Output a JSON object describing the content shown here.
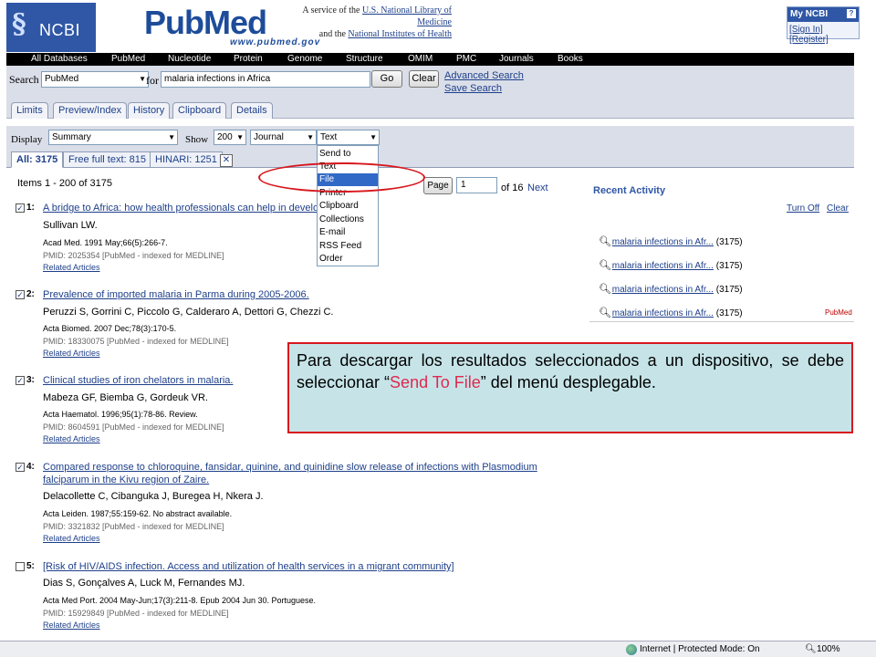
{
  "header": {
    "ncbi_logo_text": "NCBI",
    "ncbi_helix_glyph": "§",
    "pubmed_logo": "PubMed",
    "pubmed_url": "www.pubmed.gov",
    "service_line1_prefix": "A service of the ",
    "service_line1_link": "U.S. National Library of Medicine",
    "service_line2_prefix": "and the ",
    "service_line2_link": "National Institutes of Health",
    "myncbi_title": "My NCBI",
    "myncbi_help": "?",
    "sign_in": "[Sign In]",
    "register": "[Register]"
  },
  "nav": {
    "items": [
      "All Databases",
      "PubMed",
      "Nucleotide",
      "Protein",
      "Genome",
      "Structure",
      "OMIM",
      "PMC",
      "Journals",
      "Books"
    ]
  },
  "search": {
    "label": "Search",
    "database": "PubMed",
    "for_label": "for",
    "query": "malaria infections in Africa",
    "go_label": "Go",
    "clear_label": "Clear",
    "advanced_search": "Advanced Search",
    "save_search": "Save Search"
  },
  "tabs": [
    "Limits",
    "Preview/Index",
    "History",
    "Clipboard",
    "Details"
  ],
  "display": {
    "label": "Display",
    "format": "Summary",
    "show_label": "Show",
    "show_count": "200",
    "sort": "Journal",
    "send_format": "Text"
  },
  "filters": [
    {
      "label": "All: 3175",
      "active": true
    },
    {
      "label": "Free full text: 815",
      "active": false
    },
    {
      "label": "HINARI: 1251",
      "active": false
    }
  ],
  "paging": {
    "items_text": "Items 1 - 200 of 3175",
    "page_button": "Page",
    "page_value": "1",
    "of_text": "of 16",
    "next": "Next"
  },
  "dropdown": {
    "options": [
      "Send to",
      "Text",
      "File",
      "Printer",
      "Clipboard",
      "Collections",
      "E-mail",
      "RSS Feed",
      "Order"
    ],
    "selected": "File"
  },
  "results": [
    {
      "num": "1:",
      "checked": "✓",
      "title": "A bridge to Africa: how health professionals can help in developing countries.",
      "authors": "Sullivan LW.",
      "source": "Acad Med. 1991 May;66(5):266-7.",
      "pmid": "PMID: 2025354 [PubMed - indexed for MEDLINE]",
      "related": "Related Articles"
    },
    {
      "num": "2:",
      "checked": "✓",
      "title": "Prevalence of imported malaria in Parma during 2005-2006.",
      "authors": "Peruzzi S, Gorrini C, Piccolo G, Calderaro A, Dettori G, Chezzi C.",
      "source": "Acta Biomed. 2007 Dec;78(3):170-5.",
      "pmid": "PMID: 18330075 [PubMed - indexed for MEDLINE]",
      "related": "Related Articles"
    },
    {
      "num": "3:",
      "checked": "✓",
      "title": "Clinical studies of iron chelators in malaria.",
      "authors": "Mabeza GF, Biemba G, Gordeuk VR.",
      "source": "Acta Haematol. 1996;95(1):78-86. Review.",
      "pmid": "PMID: 8604591 [PubMed - indexed for MEDLINE]",
      "related": "Related Articles"
    },
    {
      "num": "4:",
      "checked": "✓",
      "title": "Compared response to chloroquine, fansidar, quinine, and quinidine slow release of infections with Plasmodium falciparum in the Kivu region of Zaire.",
      "authors": "Delacollette C, Cibanguka J, Buregea H, Nkera J.",
      "source": "Acta Leiden. 1987;55:159-62. No abstract available.",
      "pmid": "PMID: 3321832 [PubMed - indexed for MEDLINE]",
      "related": "Related Articles"
    },
    {
      "num": "5:",
      "checked": "",
      "title": "[Risk of HIV/AIDS infection. Access and utilization of health services in a migrant community]",
      "authors": "Dias S, Gonçalves A, Luck M, Fernandes MJ.",
      "source": "Acta Med Port. 2004 May-Jun;17(3):211-8. Epub 2004 Jun 30. Portuguese.",
      "pmid": "PMID: 15929849 [PubMed - indexed for MEDLINE]",
      "related": "Related Articles"
    }
  ],
  "recent": {
    "title": "Recent Activity",
    "turn_off": "Turn Off",
    "clear": "Clear",
    "items": [
      {
        "query": "malaria infections in Afr...",
        "count": "(3175)"
      },
      {
        "query": "malaria infections in Afr...",
        "count": "(3175)"
      },
      {
        "query": "malaria infections in Afr...",
        "count": "(3175)"
      },
      {
        "query": "malaria infections in Afr...",
        "count": "(3175)"
      }
    ],
    "tag": "PubMed"
  },
  "callout": {
    "before": "Para descargar los resultados seleccionados a un dispositivo, se debe seleccionar “",
    "highlight": "Send To File",
    "after": "” del menú desplegable."
  },
  "statusbar": {
    "text": "Internet | Protected Mode: On",
    "zoom": "100%"
  },
  "colors": {
    "accent": "#2f57a5",
    "annotation_red": "#d8171e",
    "callout_bg": "#c6e4e8"
  }
}
